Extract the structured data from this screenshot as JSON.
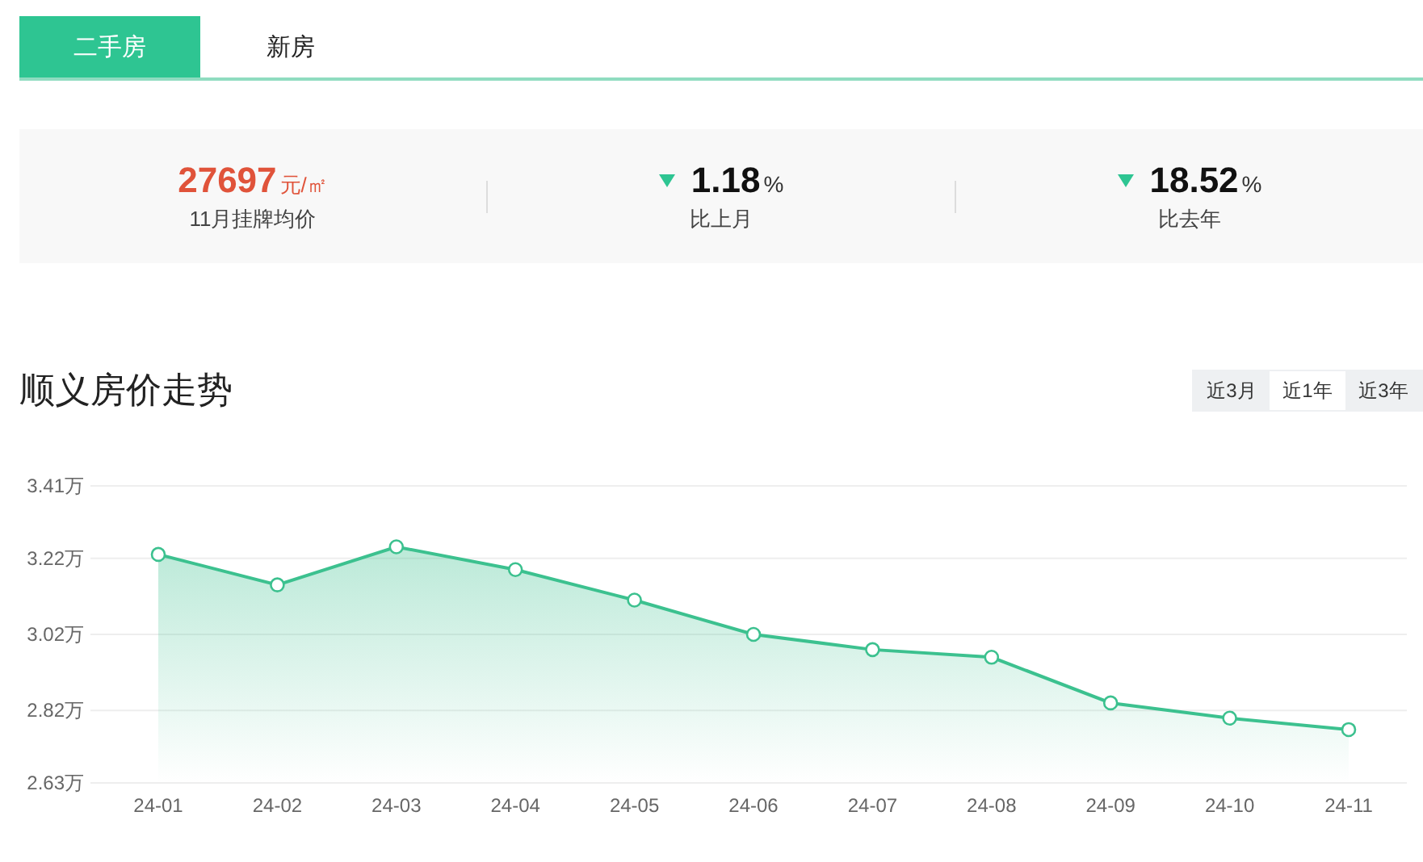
{
  "tabs": [
    {
      "label": "二手房",
      "selected": true
    },
    {
      "label": "新房",
      "selected": false
    }
  ],
  "stats": [
    {
      "kind": "price",
      "value": "27697",
      "unit": "元/㎡",
      "label": "11月挂牌均价"
    },
    {
      "kind": "change",
      "falling": true,
      "value": "1.18",
      "unit": "%",
      "label": "比上月"
    },
    {
      "kind": "change",
      "falling": true,
      "value": "18.52",
      "unit": "%",
      "label": "比去年"
    }
  ],
  "trend": {
    "title": "顺义房价走势",
    "periods": [
      {
        "label": "近3月",
        "selected": false
      },
      {
        "label": "近1年",
        "selected": true
      },
      {
        "label": "近3年",
        "selected": false
      }
    ],
    "chart_data": {
      "type": "area",
      "categories": [
        "24-01",
        "24-02",
        "24-03",
        "24-04",
        "24-05",
        "24-06",
        "24-07",
        "24-08",
        "24-09",
        "24-10",
        "24-11"
      ],
      "grid": true,
      "series": [
        {
          "color": "#3cc18f",
          "values": [
            3.23,
            3.15,
            3.25,
            3.19,
            3.11,
            3.02,
            2.98,
            2.96,
            2.84,
            2.8,
            2.77
          ]
        }
      ],
      "ylim": [
        2.63,
        3.41
      ],
      "yticks": [
        {
          "value": 3.41,
          "label": "3.41万"
        },
        {
          "value": 3.22,
          "label": "3.22万"
        },
        {
          "value": 3.02,
          "label": "3.02万"
        },
        {
          "value": 2.82,
          "label": "2.82万"
        },
        {
          "value": 2.63,
          "label": "2.63万"
        }
      ]
    }
  }
}
